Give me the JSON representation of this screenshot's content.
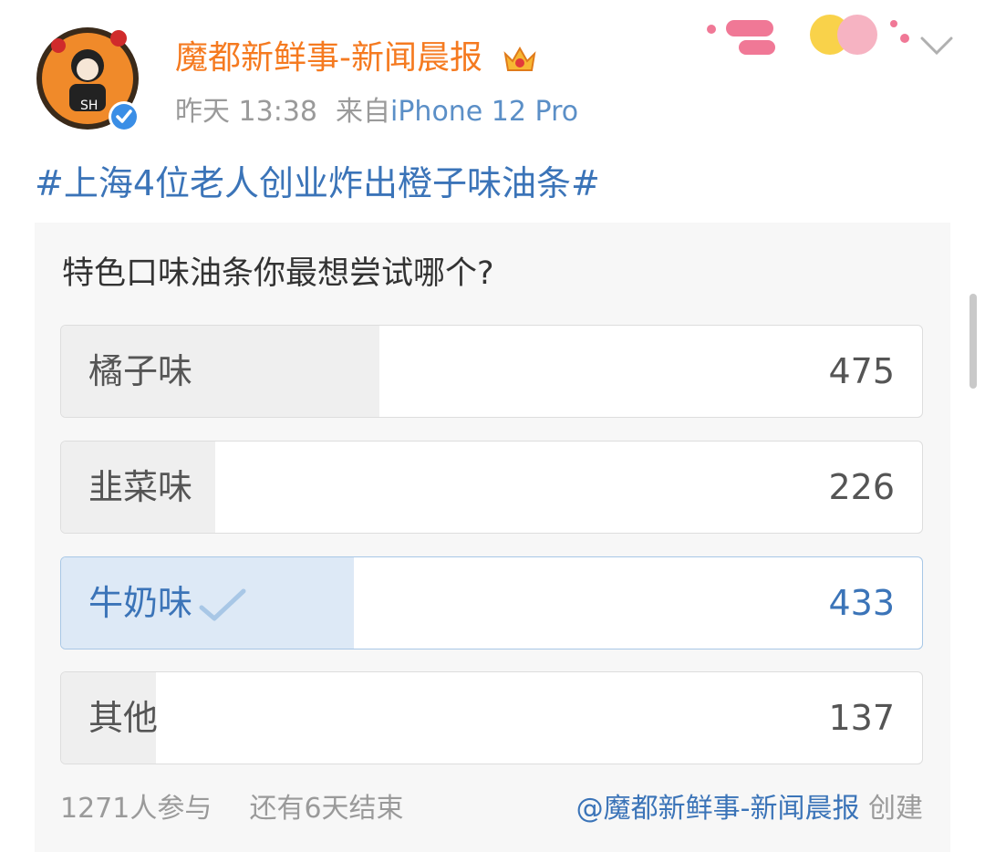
{
  "post": {
    "username": "魔都新鲜事-新闻晨报",
    "time": "昨天 13:38",
    "source_prefix": "来自",
    "source": "iPhone 12 Pro",
    "topic": "#上海4位老人创业炸出橙子味油条#",
    "avatar_initials": "SH"
  },
  "poll": {
    "question": "特色口味油条你最想尝试哪个?",
    "options": [
      {
        "label": "橘子味",
        "count": "475",
        "fill": 0.3696,
        "selected": false
      },
      {
        "label": "韭菜味",
        "count": "226",
        "fill": 0.1794,
        "selected": false
      },
      {
        "label": "牛奶味",
        "count": "433",
        "fill": 0.3403,
        "selected": true
      },
      {
        "label": "其他",
        "count": "137",
        "fill": 0.1097,
        "selected": false
      }
    ],
    "participants": "1271人参与",
    "remaining": "还有6天结束",
    "creator": "@魔都新鲜事-新闻晨报",
    "created_label": "创建"
  },
  "colors": {
    "username": "#f57a20",
    "link": "#3b74b8",
    "muted": "#9a9a9a",
    "selected_fill": "#dde9f6",
    "fill": "#efefef"
  },
  "icons": {
    "crown": "crown-icon",
    "verified": "verified-badge-icon",
    "check": "check-icon",
    "chevron": "chevron-down-icon"
  }
}
